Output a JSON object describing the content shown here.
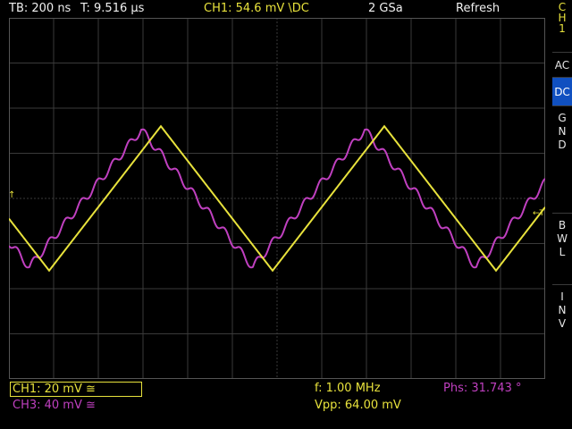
{
  "header": {
    "timebase": "TB: 200 ns",
    "trigger_time": "T: 9.516 µs",
    "ch1_trigger": "CH1: 54.6 mV \\DC",
    "sample_rate": "2 GSa",
    "acq_mode": "Refresh"
  },
  "side_menu": {
    "channel_lines": [
      "C",
      "H",
      "1"
    ],
    "ac_label": "AC",
    "dc_label": "DC",
    "gnd_lines": [
      "G",
      "N",
      "D"
    ],
    "bwl_lines": [
      "B",
      "W",
      "L"
    ],
    "inv_lines": [
      "I",
      "N",
      "V"
    ],
    "active": "DC"
  },
  "footer": {
    "ch1_scale": "CH1: 20 mV ≅",
    "ch3_scale": "CH3: 40 mV ≅",
    "frequency": "f: 1.00 MHz",
    "vpp": "Vpp: 64.00 mV",
    "phase": "Phs: 31.743 °"
  },
  "colors": {
    "ch1": "#e8e23c",
    "ch3": "#c040c0",
    "grid": "#3a3a3a",
    "active_button": "#1050c0"
  },
  "chart_data": {
    "type": "line",
    "grid": true,
    "divisions": {
      "x": 12,
      "y": 8
    },
    "series": [
      {
        "name": "CH1",
        "amplitude_v": 0.032,
        "frequency_hz": 1000000,
        "phase_deg": 0
      },
      {
        "name": "CH3",
        "amplitude_v": 0.032,
        "frequency_hz": 1000000,
        "phase_deg": 31.743
      }
    ]
  }
}
